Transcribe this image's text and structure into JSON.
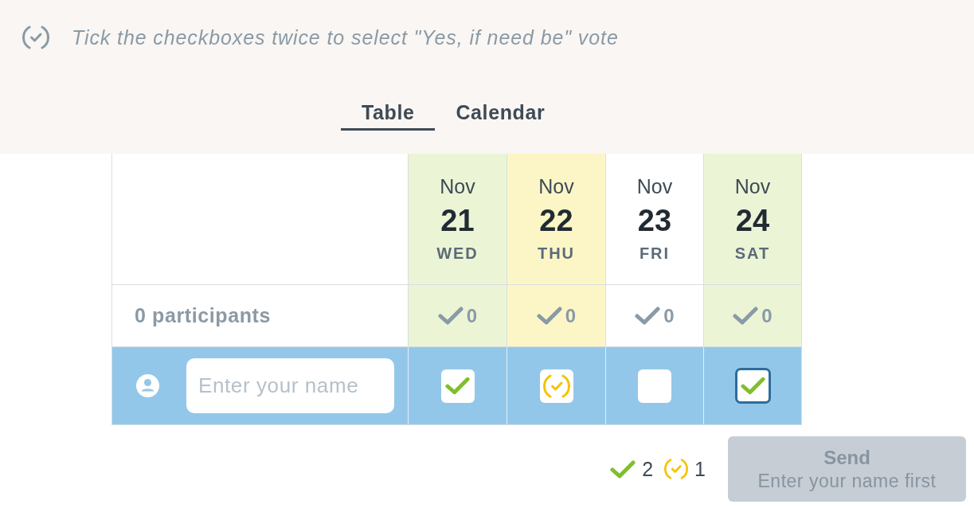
{
  "hint": {
    "text": "Tick the checkboxes twice to select \"Yes, if need be\" vote"
  },
  "tabs": [
    {
      "label": "Table",
      "selected": true
    },
    {
      "label": "Calendar",
      "selected": false
    }
  ],
  "table": {
    "participants_label": "0 participants",
    "name_field": {
      "placeholder": "Enter your name"
    },
    "dates": [
      {
        "month": "Nov",
        "day": "21",
        "weekday": "WED",
        "count": "0",
        "kind": "yes",
        "focused": false
      },
      {
        "month": "Nov",
        "day": "22",
        "weekday": "THU",
        "count": "0",
        "kind": "maybe",
        "focused": false
      },
      {
        "month": "Nov",
        "day": "23",
        "weekday": "FRI",
        "count": "0",
        "kind": "empty",
        "focused": false
      },
      {
        "month": "Nov",
        "day": "24",
        "weekday": "SAT",
        "count": "0",
        "kind": "yes",
        "focused": true
      }
    ]
  },
  "summary": [
    {
      "kind": "yes",
      "count": "2"
    },
    {
      "kind": "maybe",
      "count": "1"
    }
  ],
  "send_button": {
    "label": "Send",
    "sublabel": "Enter your name first",
    "disabled": true
  }
}
